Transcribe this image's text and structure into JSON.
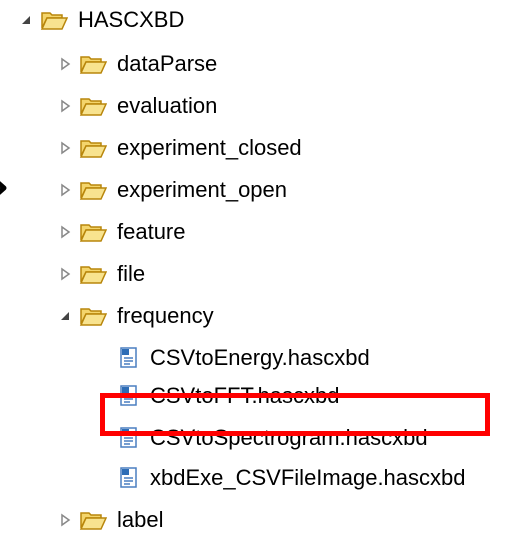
{
  "tree": {
    "root": {
      "label": "HASCXBD",
      "expanded": true
    },
    "folders": [
      {
        "label": "dataParse",
        "expanded": false
      },
      {
        "label": "evaluation",
        "expanded": false
      },
      {
        "label": "experiment_closed",
        "expanded": false
      },
      {
        "label": "experiment_open",
        "expanded": false
      },
      {
        "label": "feature",
        "expanded": false
      },
      {
        "label": "file",
        "expanded": false
      },
      {
        "label": "frequency",
        "expanded": true
      },
      {
        "label": "label",
        "expanded": false
      }
    ],
    "frequency_files": [
      {
        "label": "CSVtoEnergy.hascxbd"
      },
      {
        "label": "CSVtoFFT.hascxbd"
      },
      {
        "label": "CSVtoSpectrogram.hascxbd",
        "highlighted": true
      },
      {
        "label": "xbdExe_CSVFileImage.hascxbd"
      }
    ]
  },
  "colors": {
    "highlight_border": "#ff0000",
    "folder_fill": "#f6d86a",
    "folder_stroke": "#c79a1f",
    "toggle": "#8a8a8a",
    "file_icon": "#2e6db6"
  }
}
